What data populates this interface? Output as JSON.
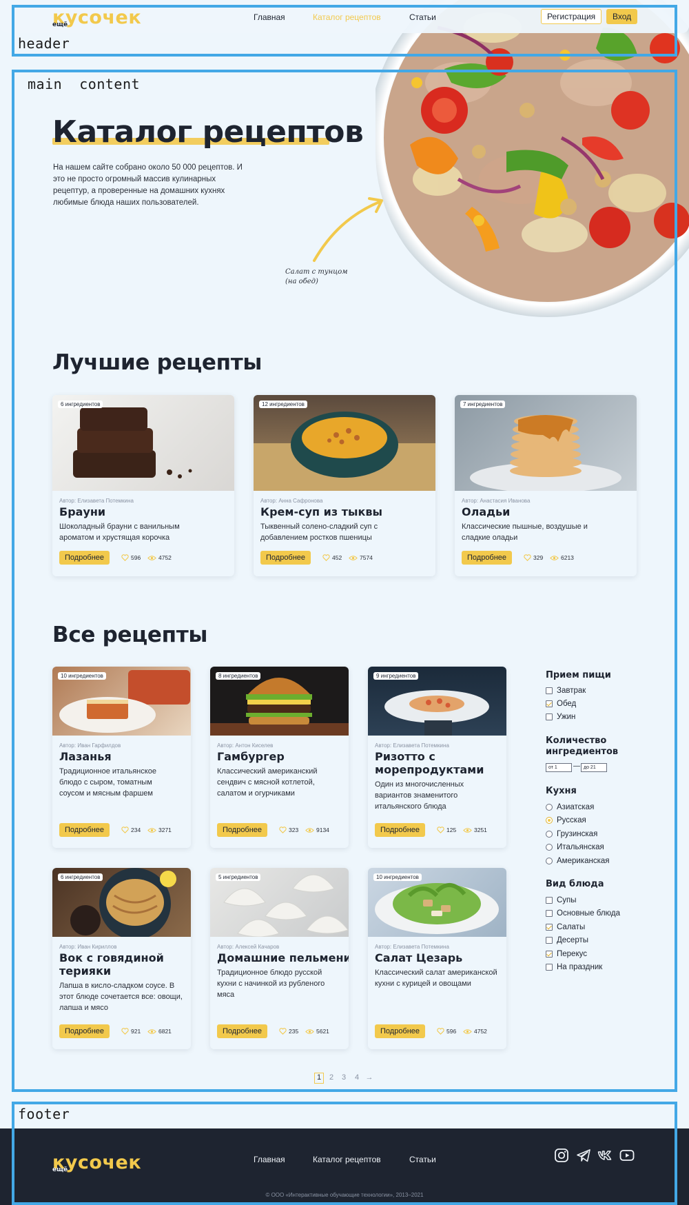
{
  "annotations": {
    "header": "header",
    "main": "main  content",
    "footer": "footer"
  },
  "header": {
    "logo_text": "кусочек",
    "logo_sup": "ещё",
    "nav": [
      "Главная",
      "Каталог рецептов",
      "Статьи"
    ],
    "register_label": "Регистрация",
    "login_label": "Вход"
  },
  "hero": {
    "title": "Каталог рецептов",
    "text": "На нашем сайте собрано около 50 000 рецептов. И это не просто огромный массив кулинарных рецептур, а проверенные на домашних кухнях любимые блюда наших пользователей.",
    "note_line1": "Салат с тунцом",
    "note_line2": "(на обед)"
  },
  "best": {
    "title": "Лучшие рецепты",
    "cards": [
      {
        "badge": "6 ингредиентов",
        "author": "Автор: Елизавета Потемкина",
        "title": "Брауни",
        "desc": "Шоколадный брауни с ванильным ароматом и хрустящая корочка",
        "more": "Подробнее",
        "likes": "596",
        "views": "4752"
      },
      {
        "badge": "12 ингредиентов",
        "author": "Автор: Анна Сафронова",
        "title": "Крем-суп из тыквы",
        "desc": "Тыквенный солено-сладкий суп с добавлением ростков пшеницы",
        "more": "Подробнее",
        "likes": "452",
        "views": "7574"
      },
      {
        "badge": "7 ингредиентов",
        "author": "Автор: Анастасия Иванова",
        "title": "Оладьи",
        "desc": "Классические пышные, воздушые и сладкие оладьи",
        "more": "Подробнее",
        "likes": "329",
        "views": "6213"
      }
    ]
  },
  "all": {
    "title": "Все рецепты",
    "cards": [
      {
        "badge": "10 ингредиентов",
        "author": "Автор: Иван Гарфилдов",
        "title": "Лазанья",
        "desc": "Традиционное итальянское блюдо с сыром, томатным соусом и мясным фаршем",
        "more": "Подробнее",
        "likes": "234",
        "views": "3271"
      },
      {
        "badge": "8 ингредиентов",
        "author": "Автор: Антон Киселев",
        "title": "Гамбургер",
        "desc": "Классический американский сендвич с мясной котлетой, салатом и огурчиками",
        "more": "Подробнее",
        "likes": "323",
        "views": "9134"
      },
      {
        "badge": "9 ингредиентов",
        "author": "Автор: Елизавета Потемкина",
        "title": "Ризотто с морепродуктами",
        "desc": "Один из многочисленных вариантов знаменитого итальянского блюда",
        "more": "Подробнее",
        "likes": "125",
        "views": "3251"
      },
      {
        "badge": "6 ингредиентов",
        "author": "Автор: Иван Кириллов",
        "title": "Вок с говядиной терияки",
        "desc": "Лапша в кисло-сладком соусе. В этот блюде сочетается все: овощи, лапша и мясо",
        "more": "Подробнее",
        "likes": "921",
        "views": "6821"
      },
      {
        "badge": "5 ингредиентов",
        "author": "Автор: Алексей Качаров",
        "title": "Домашние пельмени",
        "desc": "Традиционное блюдо русской кухни с начинкой из рубленого мяса",
        "more": "Подробнее",
        "likes": "235",
        "views": "5621"
      },
      {
        "badge": "10 ингредиентов",
        "author": "Автор: Елизавета Потемкина",
        "title": "Салат Цезарь",
        "desc": "Классический салат американской кухни с курицей и овощами",
        "more": "Подробнее",
        "likes": "596",
        "views": "4752"
      }
    ]
  },
  "filters": {
    "meal": {
      "title": "Прием пищи",
      "options": [
        {
          "label": "Завтрак",
          "checked": false
        },
        {
          "label": "Обед",
          "checked": true
        },
        {
          "label": "Ужин",
          "checked": false
        }
      ]
    },
    "count": {
      "title_line1": "Количество",
      "title_line2": "ингредиентов",
      "from_placeholder": "от 1",
      "to_placeholder": "до 21",
      "dash": "—"
    },
    "cuisine": {
      "title": "Кухня",
      "options": [
        {
          "label": "Азиатская",
          "checked": false
        },
        {
          "label": "Русская",
          "checked": true
        },
        {
          "label": "Грузинская",
          "checked": false
        },
        {
          "label": "Итальянская",
          "checked": false
        },
        {
          "label": "Американская",
          "checked": false
        }
      ]
    },
    "type": {
      "title": "Вид блюда",
      "options": [
        {
          "label": "Супы",
          "checked": false
        },
        {
          "label": "Основные блюда",
          "checked": false
        },
        {
          "label": "Салаты",
          "checked": true
        },
        {
          "label": "Десерты",
          "checked": false
        },
        {
          "label": "Перекус",
          "checked": true
        },
        {
          "label": "На праздник",
          "checked": false
        }
      ]
    }
  },
  "pagination": {
    "pages": [
      "1",
      "2",
      "3",
      "4"
    ],
    "next": "→",
    "current": "1"
  },
  "footer": {
    "logo_text": "кусочек",
    "logo_sup": "ещё",
    "nav": [
      "Главная",
      "Каталог рецептов",
      "Статьи"
    ],
    "social": [
      "instagram-icon",
      "telegram-icon",
      "vk-icon",
      "youtube-icon"
    ],
    "copyright": "© ООО «Интерактивные обучающие технологии», 2013–2021"
  },
  "colors": {
    "accent": "#f2c94c",
    "background": "#eef6fc",
    "footer": "#1e2430",
    "annotation": "#43a8e6"
  }
}
